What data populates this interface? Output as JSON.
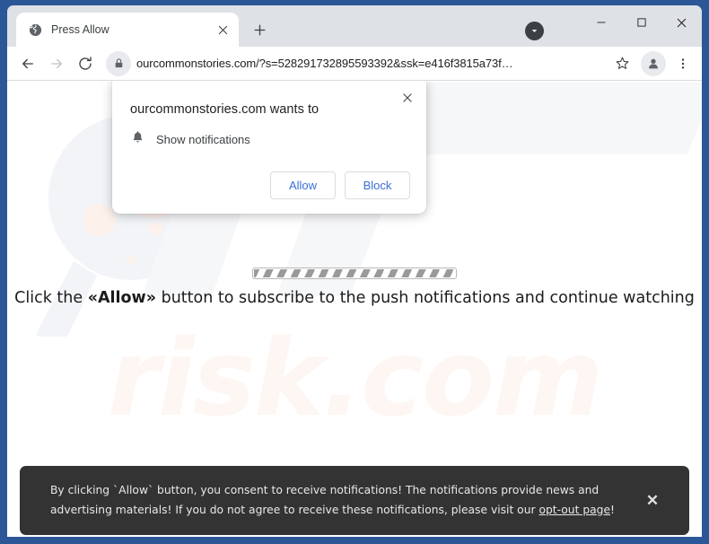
{
  "window": {
    "caption": {
      "dropdown_icon": "chevron-down-circle-icon",
      "minimize_label": "—",
      "maximize_label": "□",
      "close_label": "×"
    }
  },
  "tabstrip": {
    "tabs": [
      {
        "title": "Press Allow",
        "favicon": "globe-icon",
        "close_label": "×"
      }
    ],
    "new_tab_label": "+"
  },
  "toolbar": {
    "back_icon": "arrow-left-icon",
    "forward_icon": "arrow-right-icon",
    "reload_icon": "reload-icon",
    "lock_icon": "lock-icon",
    "url": "ourcommonstories.com/?s=528291732895593392&ssk=e416f3815a73f…",
    "bookmark_icon": "star-icon",
    "profile_icon": "person-icon",
    "menu_icon": "three-dot-menu-icon"
  },
  "dialog": {
    "title": "ourcommonstories.com wants to",
    "permission_icon": "bell-icon",
    "permission_label": "Show notifications",
    "allow_label": "Allow",
    "block_label": "Block",
    "close_label": "×",
    "accent_color": "#3b6fd4"
  },
  "page": {
    "headline_prefix": "Click the ",
    "headline_emphasis": "«Allow»",
    "headline_suffix": " button to subscribe to the push notifications and continue watching",
    "progress_label": "loading-progress-bar",
    "watermark_text": "risk.com",
    "watermark_logo": "pc-logo-watermark",
    "watermark_glass": "magnifier-watermark",
    "watermark_color": "#fdf6f2"
  },
  "consent_banner": {
    "text_before_link": "By clicking `Allow` button, you consent to receive notifications! The notifications provide news and advertising materials! If you do not agree to receive these notifications, please visit our ",
    "link_label": "opt-out page",
    "text_after_link": "!",
    "close_label": "✕",
    "background_color": "#333333"
  }
}
